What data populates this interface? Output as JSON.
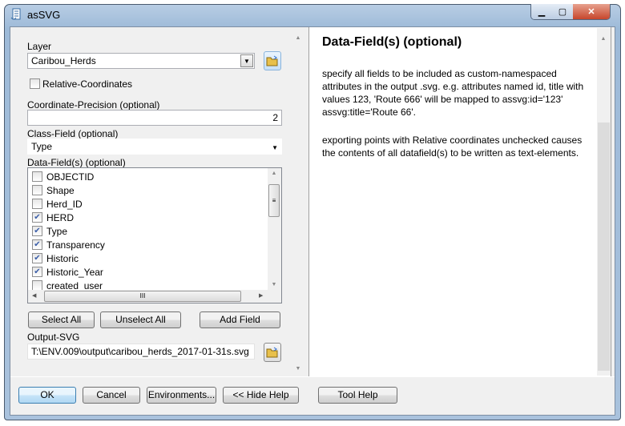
{
  "window": {
    "title": "asSVG",
    "icon": "script-tool-icon"
  },
  "layer": {
    "label": "Layer",
    "value": "Caribou_Herds"
  },
  "relative": {
    "label": "Relative-Coordinates",
    "checked": false
  },
  "precision": {
    "label": "Coordinate-Precision (optional)",
    "value": "2"
  },
  "class_field": {
    "label": "Class-Field (optional)",
    "value": "Type"
  },
  "data_fields": {
    "label": "Data-Field(s) (optional)",
    "items": [
      {
        "label": "OBJECTID",
        "checked": false
      },
      {
        "label": "Shape",
        "checked": false
      },
      {
        "label": "Herd_ID",
        "checked": false
      },
      {
        "label": "HERD",
        "checked": true
      },
      {
        "label": "Type",
        "checked": true
      },
      {
        "label": "Transparency",
        "checked": true
      },
      {
        "label": "Historic",
        "checked": true
      },
      {
        "label": "Historic_Year",
        "checked": true
      },
      {
        "label": "created_user",
        "checked": false
      }
    ]
  },
  "list_buttons": {
    "select_all": "Select All",
    "unselect_all": "Unselect All",
    "add_field": "Add Field"
  },
  "output": {
    "label": "Output-SVG",
    "value": "T:\\ENV.009\\output\\caribou_herds_2017-01-31s.svg"
  },
  "help": {
    "title": "Data-Field(s) (optional)",
    "p1": "specify all fields to be included as custom-namespaced attributes in the output .svg. e.g. attributes named id, title with values 123, 'Route 666' will be mapped to assvg:id='123' assvg:title='Route 66'.",
    "p2": "exporting points with Relative coordinates unchecked causes the contents of all datafield(s) to be written as text-elements."
  },
  "footer": {
    "ok": "OK",
    "cancel": "Cancel",
    "environments": "Environments...",
    "hide_help": "<< Hide Help",
    "tool_help": "Tool Help"
  }
}
